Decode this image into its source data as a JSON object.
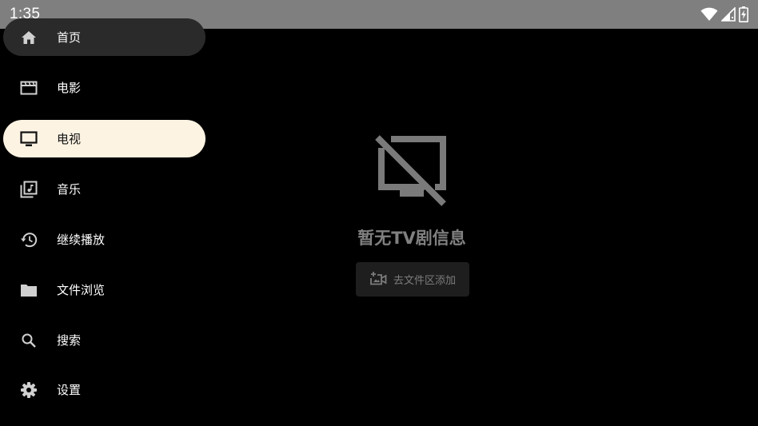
{
  "status_bar": {
    "time": "1:35"
  },
  "sidebar": {
    "items": [
      {
        "label": "首页",
        "icon": "home-icon"
      },
      {
        "label": "电影",
        "icon": "movie-icon"
      },
      {
        "label": "电视",
        "icon": "tv-icon",
        "active": true
      },
      {
        "label": "音乐",
        "icon": "music-library-icon"
      },
      {
        "label": "继续播放",
        "icon": "history-icon"
      },
      {
        "label": "文件浏览",
        "icon": "folder-icon"
      },
      {
        "label": "搜索",
        "icon": "search-icon"
      },
      {
        "label": "设置",
        "icon": "settings-icon"
      }
    ]
  },
  "empty_state": {
    "icon": "tv-off-icon",
    "title": "暂无TV剧信息",
    "button_label": "去文件区添加",
    "button_icon": "add-video-icon"
  },
  "colors": {
    "status_bar_bg": "#7f7f7f",
    "active_item_bg": "#fdf3e3",
    "first_item_bg": "#2a2a2a",
    "muted_text": "#808080"
  }
}
